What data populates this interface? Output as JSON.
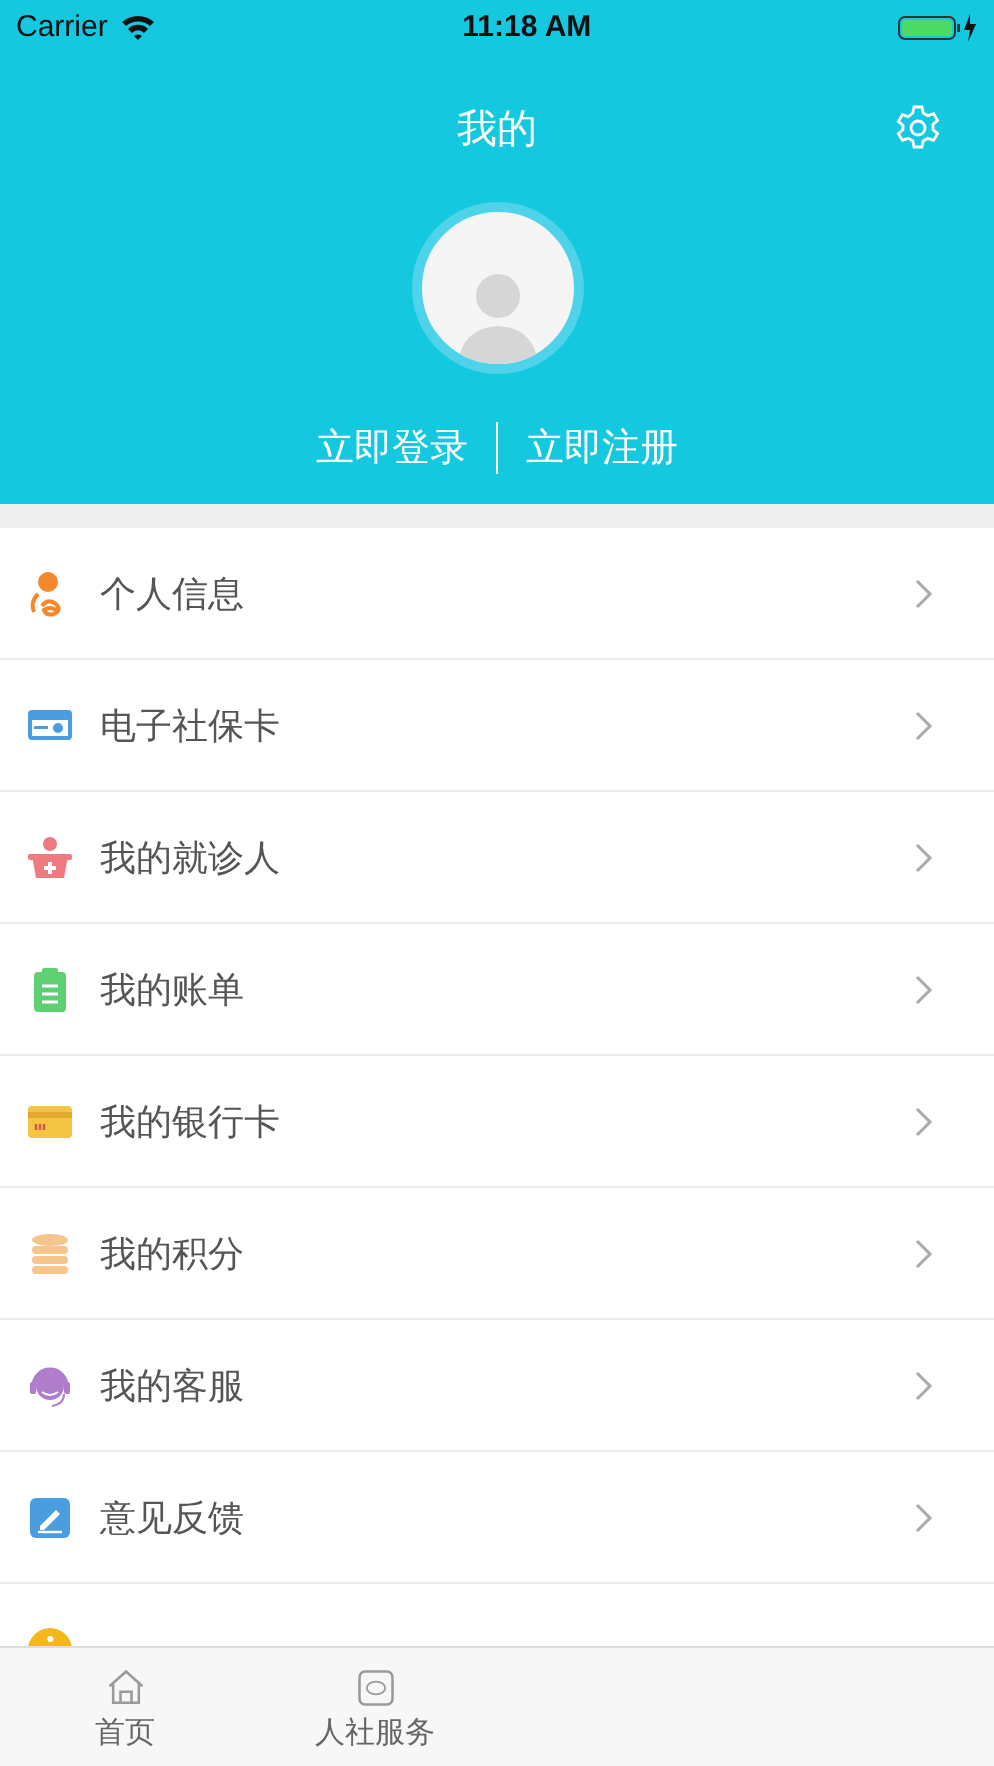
{
  "status_bar": {
    "carrier": "Carrier",
    "time": "11:18 AM"
  },
  "header": {
    "title": "我的",
    "login": "立即登录",
    "register": "立即注册"
  },
  "menu": [
    {
      "label": "个人信息"
    },
    {
      "label": "电子社保卡"
    },
    {
      "label": "我的就诊人"
    },
    {
      "label": "我的账单"
    },
    {
      "label": "我的银行卡"
    },
    {
      "label": "我的积分"
    },
    {
      "label": "我的客服"
    },
    {
      "label": "意见反馈"
    },
    {
      "kind": "partial"
    }
  ],
  "tabs": [
    {
      "label": "首页",
      "selected": false
    },
    {
      "label": "人社服务",
      "selected": false
    }
  ]
}
